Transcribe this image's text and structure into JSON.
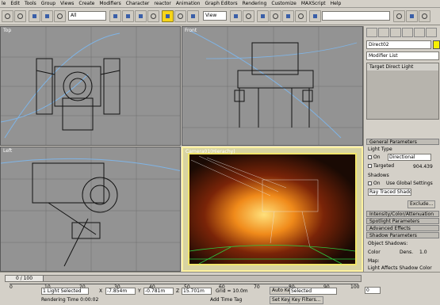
{
  "menubar": {
    "items": [
      "le",
      "Edit",
      "Tools",
      "Group",
      "Views",
      "Create",
      "Modifiers",
      "Character",
      "reactor",
      "Animation",
      "Graph Editors",
      "Rendering",
      "Customize",
      "MAXScript",
      "Help"
    ]
  },
  "toolbar": {
    "select_filter": "All",
    "ref_coord": "View",
    "named_sel": ""
  },
  "viewports": {
    "top": "Top",
    "front": "Front",
    "left": "Left",
    "camera": "Camera01(Hierachy)"
  },
  "command_panel": {
    "object_name": "Direct02",
    "modifier_list": "Modifier List",
    "stack_item": "Target Direct Light",
    "rollouts": {
      "general": "General Parameters",
      "intensity": "Intensity/Color/Attenuation",
      "spotlight": "Spotlight Parameters",
      "advanced": "Advanced Effects",
      "shadow": "Shadow Parameters"
    },
    "light_type_label": "Light Type",
    "on_label": "On",
    "light_type": "Directional",
    "targeted_label": "Targeted",
    "target_dist": "904.439",
    "shadows_label": "Shadows",
    "shadows_on": "On",
    "use_global": "Use Global Settings",
    "shadow_type": "Ray Traced Shadows",
    "exclude_btn": "Exclude...",
    "object_shadows": "Object Shadows:",
    "color": "Color",
    "dens": "Dens.",
    "dens_val": "1.0",
    "map": "Map:",
    "light_affects": "Light Affects Shadow Color"
  },
  "status": {
    "frame_readout": "0 / 100",
    "ticks": [
      "0",
      "10",
      "20",
      "30",
      "40",
      "50",
      "60",
      "70",
      "80",
      "90",
      "100"
    ],
    "sel_text": "1 Light Selected",
    "prompt_text": "Rendering Time 0:00:02",
    "x_label": "X",
    "x_val": "-7.854m",
    "y_label": "Y",
    "y_val": "-0.781m",
    "z_label": "Z",
    "z_val": "15.701m",
    "grid": "Grid = 10.0m",
    "add_time_tag": "Add Time Tag",
    "auto_key": "Auto Key",
    "selected": "Selected",
    "set_key": "Set Key",
    "key_filters": "Key Filters...",
    "frame_field": "0"
  }
}
